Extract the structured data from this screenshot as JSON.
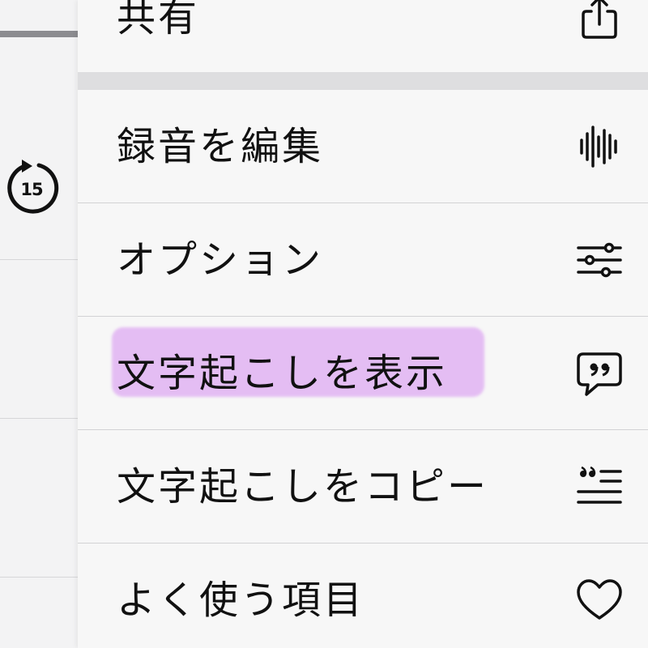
{
  "left_panel": {
    "skip_back_seconds": "15"
  },
  "menu": {
    "share": {
      "label": "共有",
      "icon": "share-icon"
    },
    "items": [
      {
        "label": "録音を編集",
        "icon": "waveform-icon"
      },
      {
        "label": "オプション",
        "icon": "sliders-icon"
      },
      {
        "label": "文字起こしを表示",
        "icon": "quote-bubble-icon",
        "highlighted": true
      },
      {
        "label": "文字起こしをコピー",
        "icon": "copy-quote-text-icon"
      },
      {
        "label": "よく使う項目",
        "icon": "heart-icon"
      }
    ]
  },
  "colors": {
    "highlight": "#e3b9f3",
    "menu_bg": "#f7f7f7",
    "separator": "#d2d2d4",
    "text": "#111111"
  }
}
